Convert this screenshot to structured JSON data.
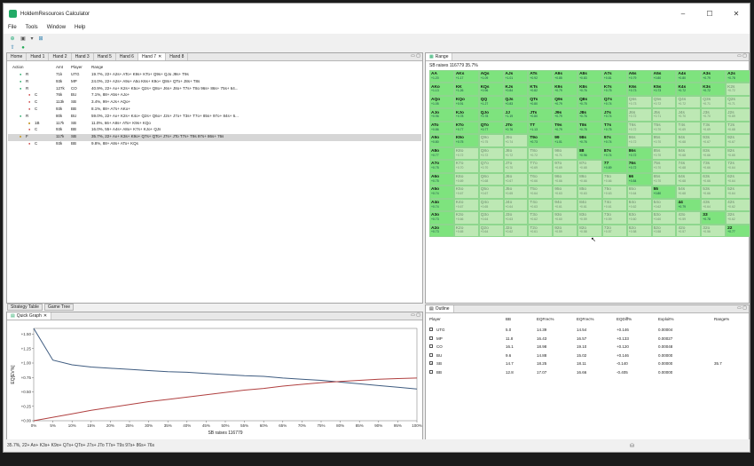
{
  "title": "HoldemResources Calculator",
  "menu": [
    "File",
    "Tools",
    "Window",
    "Help"
  ],
  "tabs": [
    "Home",
    "Hand 1",
    "Hand 2",
    "Hand 3",
    "Hand 5",
    "Hand 6",
    "Hand 7",
    "Hand 8"
  ],
  "active_tab": "Hand 7",
  "actions_header": {
    "action": "Action",
    "amt": "Amt",
    "player": "Player",
    "range": "Range"
  },
  "actions": [
    {
      "act": "R",
      "amt": "71k",
      "player": "UTG",
      "range": "19.7%, 22+ A2s+ ATo+ K9s+ KTo+ Q9s+ QJo J9s+ T9s"
    },
    {
      "act": "R",
      "amt": "93k",
      "player": "MP",
      "range": "24.0%, 22+ A2s+ A9o+ A5o K6s+ K9o+ Q8s+ QTo+ J8s+ T8s"
    },
    {
      "act": "R",
      "amt": "127k",
      "player": "CO",
      "range": "40.9%, 22+ Ax+ K2s+ K5o+ Q2s+ Q8o+ J6s+ J8o+ T7s+ T8o 96s+ 86s+ 75s+ 64..."
    },
    {
      "act": "C",
      "amt": "76k",
      "player": "BU",
      "range": "7.1%, 88+ A5s+ AJo+"
    },
    {
      "act": "C",
      "amt": "113k",
      "player": "SB",
      "range": "3.4%, 99+ AJs+ AQo+"
    },
    {
      "act": "C",
      "amt": "93k",
      "player": "BB",
      "range": "8.1%, 88+ A7s+ AKo+"
    },
    {
      "act": "R",
      "amt": "80k",
      "player": "BU",
      "range": "59.0%, 22+ Ax+ K2s+ K4o+ Q2s+ Q6o+ J2s+ J7o+ T3s+ T7o+ 85s+ 97o+ 84s+ 6..."
    },
    {
      "act": "1B",
      "amt": "117k",
      "player": "SB",
      "range": "11.0%, 66+ A8s+ ATo+ K9s+ KQo"
    },
    {
      "act": "C",
      "amt": "93k",
      "player": "BB",
      "range": "16.0%, 55+ A4s+ A8o+ K7s+ KJo+ QJs"
    },
    {
      "act": "F",
      "amt": "117k",
      "player": "SB",
      "range": "35.7%, 22+ Ax+ K3s+ K9o+ Q7s+ QTo+ J7s+ JTo T7s+ T9s 97s+ 86s+ 76s"
    },
    {
      "act": "C",
      "amt": "93k",
      "player": "BB",
      "range": "9.8%, 88+ A8s+ ATo+ KQs"
    }
  ],
  "range_tab": "Range",
  "range_header": "SB raises 116779 35.7%",
  "range_grid": [
    [
      [
        "AA",
        "+1.20"
      ],
      [
        "AKs",
        "+1.17"
      ],
      [
        "AQs",
        "+1.09"
      ],
      [
        "AJs",
        "+1.01"
      ],
      [
        "ATs",
        "+0.92"
      ],
      [
        "A9s",
        "+0.85"
      ],
      [
        "A8s",
        "+0.83"
      ],
      [
        "A7s",
        "+0.81"
      ],
      [
        "A6s",
        "+0.79"
      ],
      [
        "A5s",
        "+0.80"
      ],
      [
        "A4s",
        "+0.80"
      ],
      [
        "A3s",
        "+0.79"
      ],
      [
        "A2s",
        "+0.78"
      ]
    ],
    [
      [
        "AKo",
        "+1.13"
      ],
      [
        "KK",
        "+1.26"
      ],
      [
        "KQs",
        "+0.96"
      ],
      [
        "KJs",
        "+0.84"
      ],
      [
        "KTs",
        "+0.82"
      ],
      [
        "K9s",
        "+0.79"
      ],
      [
        "K8s",
        "+0.76"
      ],
      [
        "K7s",
        "+0.75"
      ],
      [
        "K6s",
        "+0.73"
      ],
      [
        "K5s",
        "+0.73"
      ],
      [
        "K4s",
        "+0.72"
      ],
      [
        "K3s",
        "+0.72"
      ],
      [
        "K2s",
        "+0.72"
      ]
    ],
    [
      [
        "AQo",
        "+1.05"
      ],
      [
        "KQo",
        "+0.91"
      ],
      [
        "QQ",
        "+1.27"
      ],
      [
        "QJs",
        "+0.83"
      ],
      [
        "QTs",
        "+0.80"
      ],
      [
        "Q9s",
        "+0.79"
      ],
      [
        "Q8s",
        "+0.75"
      ],
      [
        "Q7s",
        "+0.74"
      ],
      [
        "Q6s",
        "+0.73"
      ],
      [
        "Q5s",
        "+0.72"
      ],
      [
        "Q4s",
        "+0.72"
      ],
      [
        "Q3s",
        "+0.71"
      ],
      [
        "Q2s",
        "+0.71"
      ]
    ],
    [
      [
        "AJo",
        "+0.96"
      ],
      [
        "KJo",
        "+0.78"
      ],
      [
        "QJo",
        "+0.78"
      ],
      [
        "JJ",
        "+1.19"
      ],
      [
        "JTs",
        "+0.80"
      ],
      [
        "J9s",
        "+0.79"
      ],
      [
        "J8s",
        "+0.76"
      ],
      [
        "J7s",
        "+0.74"
      ],
      [
        "J6s",
        "+0.72"
      ],
      [
        "J5s",
        "+0.71"
      ],
      [
        "J4s",
        "+0.70"
      ],
      [
        "J3s",
        "+0.70"
      ],
      [
        "J2s",
        "+0.69"
      ]
    ],
    [
      [
        "ATo",
        "+0.86"
      ],
      [
        "KTo",
        "+0.77"
      ],
      [
        "QTo",
        "+0.77"
      ],
      [
        "JTo",
        "+0.76"
      ],
      [
        "TT",
        "+1.13"
      ],
      [
        "T9s",
        "+0.79"
      ],
      [
        "T8s",
        "+0.78"
      ],
      [
        "T7s",
        "+0.75"
      ],
      [
        "T6s",
        "+0.72"
      ],
      [
        "T5s",
        "+0.70"
      ],
      [
        "T4s",
        "+0.69"
      ],
      [
        "T3s",
        "+0.69"
      ],
      [
        "T2s",
        "+0.68"
      ]
    ],
    [
      [
        "A9o",
        "+0.80"
      ],
      [
        "K9o",
        "+0.75"
      ],
      [
        "Q9o",
        "+0.75"
      ],
      [
        "J9o",
        "+0.74"
      ],
      [
        "T9o",
        "+0.73"
      ],
      [
        "99",
        "+1.01"
      ],
      [
        "98s",
        "+0.76"
      ],
      [
        "97s",
        "+0.74"
      ],
      [
        "96s",
        "+0.72"
      ],
      [
        "95s",
        "+0.70"
      ],
      [
        "94s",
        "+0.68"
      ],
      [
        "93s",
        "+0.67"
      ],
      [
        "92s",
        "+0.67"
      ]
    ],
    [
      [
        "A8o",
        "+0.77"
      ],
      [
        "K8o",
        "+0.72"
      ],
      [
        "Q8o",
        "+0.72"
      ],
      [
        "J8o",
        "+0.72"
      ],
      [
        "T8o",
        "+0.72"
      ],
      [
        "98o",
        "+0.71"
      ],
      [
        "88",
        "+0.96"
      ],
      [
        "87s",
        "+0.74"
      ],
      [
        "86s",
        "+0.72"
      ],
      [
        "85s",
        "+0.70"
      ],
      [
        "84s",
        "+0.68"
      ],
      [
        "83s",
        "+0.66"
      ],
      [
        "82s",
        "+0.65"
      ]
    ],
    [
      [
        "A7o",
        "+0.75"
      ],
      [
        "K7o",
        "+0.70"
      ],
      [
        "Q7o",
        "+0.70"
      ],
      [
        "J7o",
        "+0.70"
      ],
      [
        "T7o",
        "+0.69"
      ],
      [
        "97o",
        "+0.69"
      ],
      [
        "87o",
        "+0.68"
      ],
      [
        "77",
        "+0.89"
      ],
      [
        "76s",
        "+0.72"
      ],
      [
        "75s",
        "+0.70"
      ],
      [
        "74s",
        "+0.68"
      ],
      [
        "73s",
        "+0.66"
      ],
      [
        "72s",
        "+0.64"
      ]
    ],
    [
      [
        "A6o",
        "+0.75"
      ],
      [
        "K6o",
        "+0.69"
      ],
      [
        "Q6o",
        "+0.68"
      ],
      [
        "J6o",
        "+0.67"
      ],
      [
        "T6o",
        "+0.66"
      ],
      [
        "96o",
        "+0.66"
      ],
      [
        "86o",
        "+0.66"
      ],
      [
        "76o",
        "+0.66"
      ],
      [
        "66",
        "+0.84"
      ],
      [
        "65s",
        "+0.70"
      ],
      [
        "64s",
        "+0.68"
      ],
      [
        "63s",
        "+0.66"
      ],
      [
        "62s",
        "+0.64"
      ]
    ],
    [
      [
        "A5o",
        "+0.74"
      ],
      [
        "K5o",
        "+0.67"
      ],
      [
        "Q5o",
        "+0.67"
      ],
      [
        "J5o",
        "+0.65"
      ],
      [
        "T5o",
        "+0.64"
      ],
      [
        "95o",
        "+0.63"
      ],
      [
        "85o",
        "+0.63"
      ],
      [
        "75o",
        "+0.63"
      ],
      [
        "65o",
        "+0.64"
      ],
      [
        "55",
        "+0.80"
      ],
      [
        "54s",
        "+0.68"
      ],
      [
        "53s",
        "+0.66"
      ],
      [
        "52s",
        "+0.64"
      ]
    ],
    [
      [
        "A4o",
        "+0.74"
      ],
      [
        "K4o",
        "+0.67"
      ],
      [
        "Q4o",
        "+0.65"
      ],
      [
        "J4o",
        "+0.64"
      ],
      [
        "T4o",
        "+0.63"
      ],
      [
        "94o",
        "+0.61"
      ],
      [
        "84o",
        "+0.61"
      ],
      [
        "74o",
        "+0.61"
      ],
      [
        "64o",
        "+0.62"
      ],
      [
        "54o",
        "+0.62"
      ],
      [
        "44",
        "+0.79"
      ],
      [
        "43s",
        "+0.64"
      ],
      [
        "42s",
        "+0.62"
      ]
    ],
    [
      [
        "A3o",
        "+0.73"
      ],
      [
        "K3o",
        "+0.66"
      ],
      [
        "Q3o",
        "+0.64"
      ],
      [
        "J3o",
        "+0.63"
      ],
      [
        "T3o",
        "+0.62"
      ],
      [
        "93o",
        "+0.60"
      ],
      [
        "83o",
        "+0.59"
      ],
      [
        "73o",
        "+0.59"
      ],
      [
        "63o",
        "+0.60"
      ],
      [
        "53o",
        "+0.60"
      ],
      [
        "43o",
        "+0.59"
      ],
      [
        "33",
        "+0.78"
      ],
      [
        "32s",
        "+0.62"
      ]
    ],
    [
      [
        "A2o",
        "+0.73"
      ],
      [
        "K2o",
        "+0.65"
      ],
      [
        "Q2o",
        "+0.64"
      ],
      [
        "J2o",
        "+0.62"
      ],
      [
        "T2o",
        "+0.61"
      ],
      [
        "92o",
        "+0.59"
      ],
      [
        "82o",
        "+0.58"
      ],
      [
        "72o",
        "+0.57"
      ],
      [
        "62o",
        "+0.58"
      ],
      [
        "52o",
        "+0.58"
      ],
      [
        "42o",
        "+0.57"
      ],
      [
        "32o",
        "+0.56"
      ],
      [
        "22",
        "+0.77"
      ]
    ]
  ],
  "range_included": [
    [
      1,
      1,
      1,
      1,
      1,
      1,
      1,
      1,
      1,
      1,
      1,
      1,
      1
    ],
    [
      1,
      1,
      1,
      1,
      1,
      1,
      1,
      1,
      1,
      1,
      1,
      1,
      0
    ],
    [
      1,
      1,
      1,
      1,
      1,
      1,
      1,
      1,
      0,
      0,
      0,
      0,
      0
    ],
    [
      1,
      1,
      1,
      1,
      1,
      1,
      1,
      1,
      0,
      0,
      0,
      0,
      0
    ],
    [
      1,
      1,
      1,
      1,
      1,
      1,
      1,
      1,
      0,
      0,
      0,
      0,
      0
    ],
    [
      1,
      1,
      0,
      0,
      1,
      1,
      1,
      1,
      0,
      0,
      0,
      0,
      0
    ],
    [
      1,
      0,
      0,
      0,
      0,
      0,
      1,
      1,
      1,
      0,
      0,
      0,
      0
    ],
    [
      1,
      0,
      0,
      0,
      0,
      0,
      0,
      1,
      1,
      0,
      0,
      0,
      0
    ],
    [
      1,
      0,
      0,
      0,
      0,
      0,
      0,
      0,
      1,
      0,
      0,
      0,
      0
    ],
    [
      1,
      0,
      0,
      0,
      0,
      0,
      0,
      0,
      0,
      1,
      0,
      0,
      0
    ],
    [
      1,
      0,
      0,
      0,
      0,
      0,
      0,
      0,
      0,
      0,
      1,
      0,
      0
    ],
    [
      1,
      0,
      0,
      0,
      0,
      0,
      0,
      0,
      0,
      0,
      0,
      1,
      0
    ],
    [
      1,
      0,
      0,
      0,
      0,
      0,
      0,
      0,
      0,
      0,
      0,
      0,
      1
    ]
  ],
  "bottom_tabs": [
    "Strategy Table",
    "Game Tree"
  ],
  "quick_graph_tab": "Quick Graph",
  "chart_data": {
    "type": "line",
    "xlabel": "SB raises 116779",
    "ylabel": "EQ[EV%]",
    "x": [
      0,
      5,
      10,
      15,
      20,
      25,
      30,
      35,
      40,
      45,
      50,
      55,
      60,
      65,
      70,
      75,
      80,
      85,
      90,
      95,
      100
    ],
    "x_ticks": [
      "0%",
      "5%",
      "10%",
      "15%",
      "20%",
      "25%",
      "30%",
      "35%",
      "40%",
      "45%",
      "50%",
      "55%",
      "60%",
      "65%",
      "70%",
      "75%",
      "80%",
      "85%",
      "90%",
      "95%",
      "100%"
    ],
    "y_ticks": [
      "+0.00",
      "+0.25",
      "+0.50",
      "+0.75",
      "+1.00",
      "+1.25",
      "+1.50"
    ],
    "ylim": [
      0,
      1.6
    ],
    "series": [
      {
        "color": "#3f5c80",
        "values": [
          1.6,
          1.05,
          0.97,
          0.93,
          0.91,
          0.89,
          0.87,
          0.85,
          0.84,
          0.82,
          0.8,
          0.78,
          0.77,
          0.74,
          0.72,
          0.7,
          0.67,
          0.64,
          0.61,
          0.58,
          0.55
        ]
      },
      {
        "color": "#b04040",
        "values": [
          0.0,
          0.06,
          0.12,
          0.18,
          0.23,
          0.28,
          0.33,
          0.37,
          0.41,
          0.45,
          0.49,
          0.53,
          0.56,
          0.6,
          0.63,
          0.66,
          0.68,
          0.7,
          0.72,
          0.73,
          0.74
        ]
      }
    ]
  },
  "outline_tab": "Outline",
  "outline_header": [
    "Player",
    "BB",
    "EQFrec%",
    "EQFrec%",
    "EQDiff%",
    "Exploit%",
    "Range%"
  ],
  "outline_rows": [
    {
      "checked": false,
      "player": "UTG",
      "bb": "5.0",
      "c1": "14.39",
      "c2": "14.54",
      "c3": "+0.146",
      "c4": "0.00004",
      "c5": ""
    },
    {
      "checked": false,
      "player": "MP",
      "bb": "11.8",
      "c1": "16.43",
      "c2": "16.57",
      "c3": "+0.133",
      "c4": "0.00027",
      "c5": ""
    },
    {
      "checked": false,
      "player": "CO",
      "bb": "16.1",
      "c1": "18.98",
      "c2": "19.10",
      "c3": "+0.120",
      "c4": "0.00048",
      "c5": ""
    },
    {
      "checked": false,
      "player": "BU",
      "bb": "9.6",
      "c1": "14.88",
      "c2": "15.02",
      "c3": "+0.146",
      "c4": "0.00000",
      "c5": ""
    },
    {
      "checked": true,
      "player": "SB",
      "bb": "14.7",
      "c1": "18.25",
      "c2": "18.11",
      "c3": "-0.140",
      "c4": "0.00000",
      "c5": "35.7"
    },
    {
      "checked": false,
      "player": "BB",
      "bb": "12.8",
      "c1": "17.07",
      "c2": "16.66",
      "c3": "-0.405",
      "c4": "0.00000",
      "c5": ""
    }
  ],
  "status": "35.7%, 22+ Ax+ K3s+ K9o+ Q7s+ QTo+ J7s+ JTo T7s+ T9s 97s+ 86s+ 76s"
}
